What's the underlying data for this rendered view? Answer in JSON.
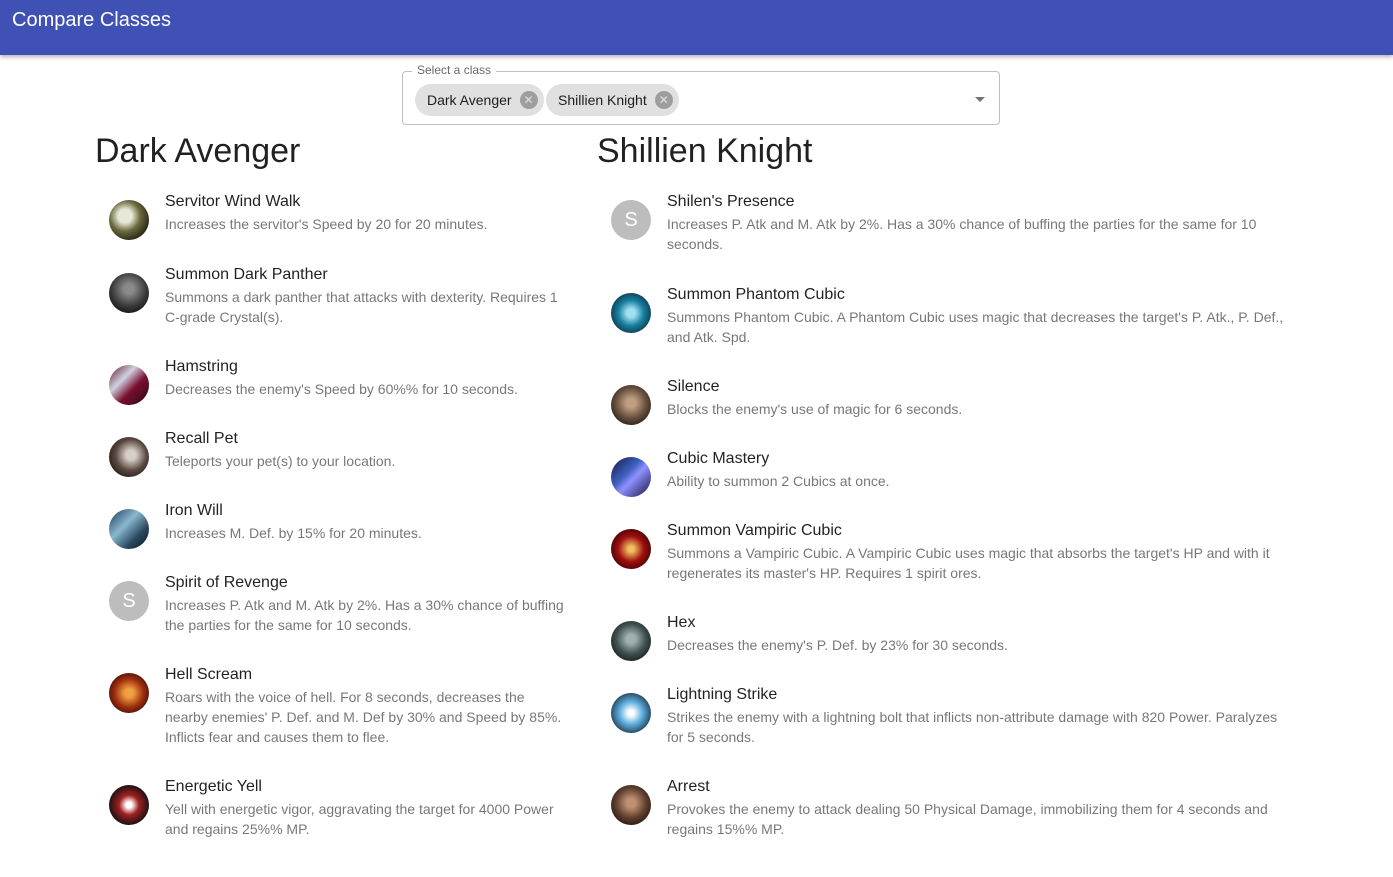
{
  "app": {
    "title": "Compare Classes"
  },
  "select": {
    "label": "Select a class",
    "chips": [
      "Dark Avenger",
      "Shillien Knight"
    ]
  },
  "colors": {
    "appbar": "#3f51b5"
  },
  "columns": [
    {
      "title": "Dark Avenger",
      "skills": [
        {
          "name": "Servitor Wind Walk",
          "desc": "Increases the servitor's Speed by 20 for 20 minutes.",
          "icon": "wolf-icon"
        },
        {
          "name": "Summon Dark Panther",
          "desc": "Summons a dark panther that attacks with dexterity. Requires 1 C-grade Crystal(s).",
          "icon": "panther-icon"
        },
        {
          "name": "Hamstring",
          "desc": "Decreases the enemy's Speed by 60%% for 10 seconds.",
          "icon": "hamstring-icon"
        },
        {
          "name": "Recall Pet",
          "desc": "Teleports your pet(s) to your location.",
          "icon": "recall-icon"
        },
        {
          "name": "Iron Will",
          "desc": "Increases M. Def. by 15% for 20 minutes.",
          "icon": "iron-will-icon"
        },
        {
          "name": "Spirit of Revenge",
          "desc": "Increases P. Atk and M. Atk by 2%. Has a 30% chance of buffing the parties for the same for 10 seconds.",
          "icon": "letter-avatar",
          "letter": "S"
        },
        {
          "name": "Hell Scream",
          "desc": "Roars with the voice of hell. For 8 seconds, decreases the nearby enemies' P. Def. and M. Def by 30% and Speed by 85%. Inflicts fear and causes them to flee.",
          "icon": "scream-icon"
        },
        {
          "name": "Energetic Yell",
          "desc": "Yell with energetic vigor, aggravating the target for 4000 Power and regains 25%% MP.",
          "icon": "yell-icon"
        }
      ]
    },
    {
      "title": "Shillien Knight",
      "skills": [
        {
          "name": "Shilen's Presence",
          "desc": "Increases P. Atk and M. Atk by 2%. Has a 30% chance of buffing the parties for the same for 10 seconds.",
          "icon": "letter-avatar",
          "letter": "S"
        },
        {
          "name": "Summon Phantom Cubic",
          "desc": "Summons Phantom Cubic. A Phantom Cubic uses magic that decreases the target's P. Atk., P. Def., and Atk. Spd.",
          "icon": "phantom-cubic-icon"
        },
        {
          "name": "Silence",
          "desc": "Blocks the enemy's use of magic for 6 seconds.",
          "icon": "silence-icon"
        },
        {
          "name": "Cubic Mastery",
          "desc": "Ability to summon 2 Cubics at once.",
          "icon": "cubic-mastery-icon"
        },
        {
          "name": "Summon Vampiric Cubic",
          "desc": "Summons a Vampiric Cubic. A Vampiric Cubic uses magic that absorbs the target's HP and with it regenerates its master's HP. Requires 1 spirit ores.",
          "icon": "vampiric-cubic-icon"
        },
        {
          "name": "Hex",
          "desc": "Decreases the enemy's P. Def. by 23% for 30 seconds.",
          "icon": "hex-icon"
        },
        {
          "name": "Lightning Strike",
          "desc": "Strikes the enemy with a lightning bolt that inflicts non-attribute damage with 820 Power. Paralyzes for 5 seconds.",
          "icon": "lightning-icon"
        },
        {
          "name": "Arrest",
          "desc": "Provokes the enemy to attack dealing 50 Physical Damage, immobilizing them for 4 seconds and regains 15%% MP.",
          "icon": "arrest-icon"
        }
      ]
    }
  ]
}
